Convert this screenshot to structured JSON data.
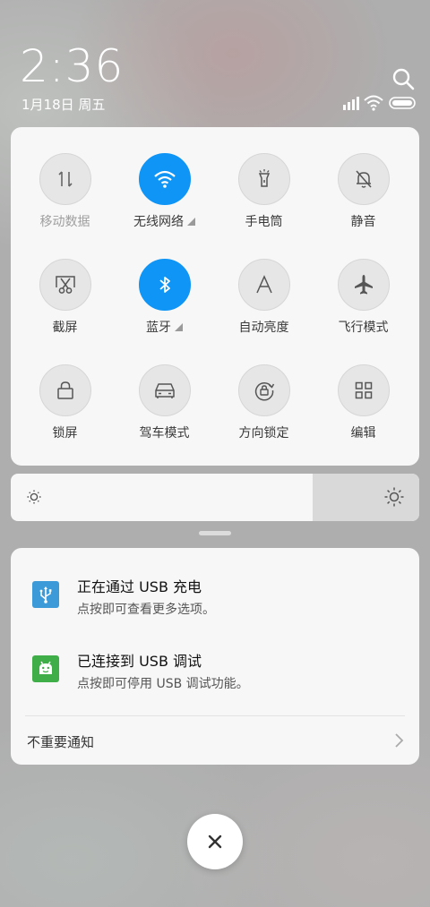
{
  "status": {
    "time": "2:36",
    "date": "1月18日 周五"
  },
  "quick_settings": {
    "tiles": [
      {
        "label": "移动数据",
        "icon": "mobile-data-icon",
        "state": "off"
      },
      {
        "label": "无线网络",
        "icon": "wifi-icon",
        "state": "on"
      },
      {
        "label": "手电筒",
        "icon": "flashlight-icon",
        "state": "off"
      },
      {
        "label": "静音",
        "icon": "silent-bell-icon",
        "state": "off"
      },
      {
        "label": "截屏",
        "icon": "screenshot-icon",
        "state": "off"
      },
      {
        "label": "蓝牙",
        "icon": "bluetooth-icon",
        "state": "on"
      },
      {
        "label": "自动亮度",
        "icon": "auto-brightness-icon",
        "state": "off"
      },
      {
        "label": "飞行模式",
        "icon": "airplane-icon",
        "state": "off"
      },
      {
        "label": "锁屏",
        "icon": "lock-icon",
        "state": "off"
      },
      {
        "label": "驾车模式",
        "icon": "car-icon",
        "state": "off"
      },
      {
        "label": "方向锁定",
        "icon": "rotation-lock-icon",
        "state": "off"
      },
      {
        "label": "编辑",
        "icon": "edit-grid-icon",
        "state": "off"
      }
    ]
  },
  "brightness": {
    "level_fraction": 0.74
  },
  "notifications": {
    "items": [
      {
        "title": "正在通过 USB 充电",
        "subtitle": "点按即可查看更多选项。",
        "icon": "usb-icon"
      },
      {
        "title": "已连接到 USB 调试",
        "subtitle": "点按即可停用 USB 调试功能。",
        "icon": "android-debug-icon"
      }
    ],
    "unimportant_label": "不重要通知"
  },
  "colors": {
    "accent": "#0e95f6",
    "usb_icon_bg": "#3d9ad8",
    "debug_icon_bg": "#3fae49"
  }
}
